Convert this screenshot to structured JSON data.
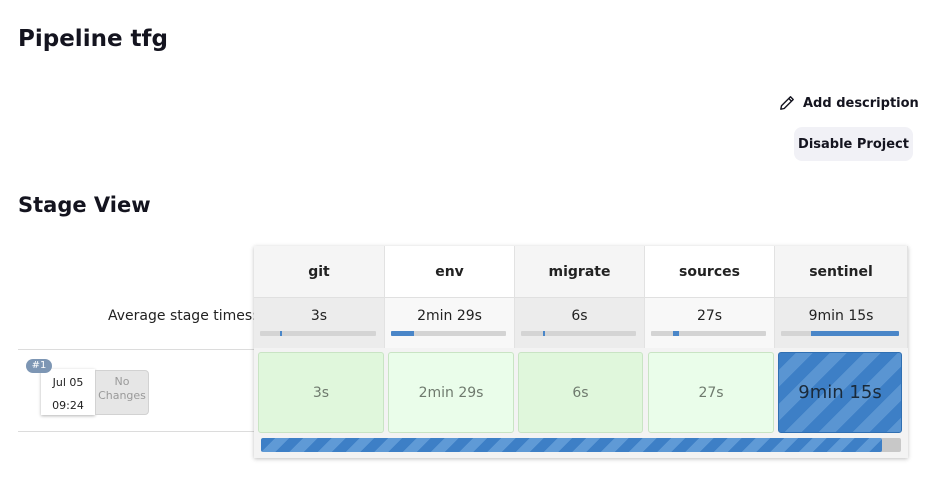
{
  "page": {
    "title": "Pipeline tfg"
  },
  "actions": {
    "add_description": "Add description",
    "disable_project": "Disable Project"
  },
  "stage_view": {
    "title": "Stage View",
    "avg_label": "Average stage times:",
    "stages": [
      {
        "name": "git",
        "avg": "3s",
        "avg_fraction": 0.02
      },
      {
        "name": "env",
        "avg": "2min 29s",
        "avg_fraction": 0.2
      },
      {
        "name": "migrate",
        "avg": "6s",
        "avg_fraction": 0.02
      },
      {
        "name": "sources",
        "avg": "27s",
        "avg_fraction": 0.05
      },
      {
        "name": "sentinel",
        "avg": "9min 15s",
        "avg_fraction": 0.75
      }
    ],
    "run": {
      "number": "#1",
      "date": "Jul 05",
      "time": "09:24",
      "changes": "No Changes",
      "progress_fraction": 0.97,
      "durations": [
        "3s",
        "2min 29s",
        "6s",
        "27s",
        "9min 15s"
      ]
    }
  },
  "colors": {
    "running": "#3d7fc6",
    "success_cell": "#e0f7dc",
    "badge": "#7d96b4"
  },
  "icons": {
    "add_description": "pencil-icon"
  }
}
